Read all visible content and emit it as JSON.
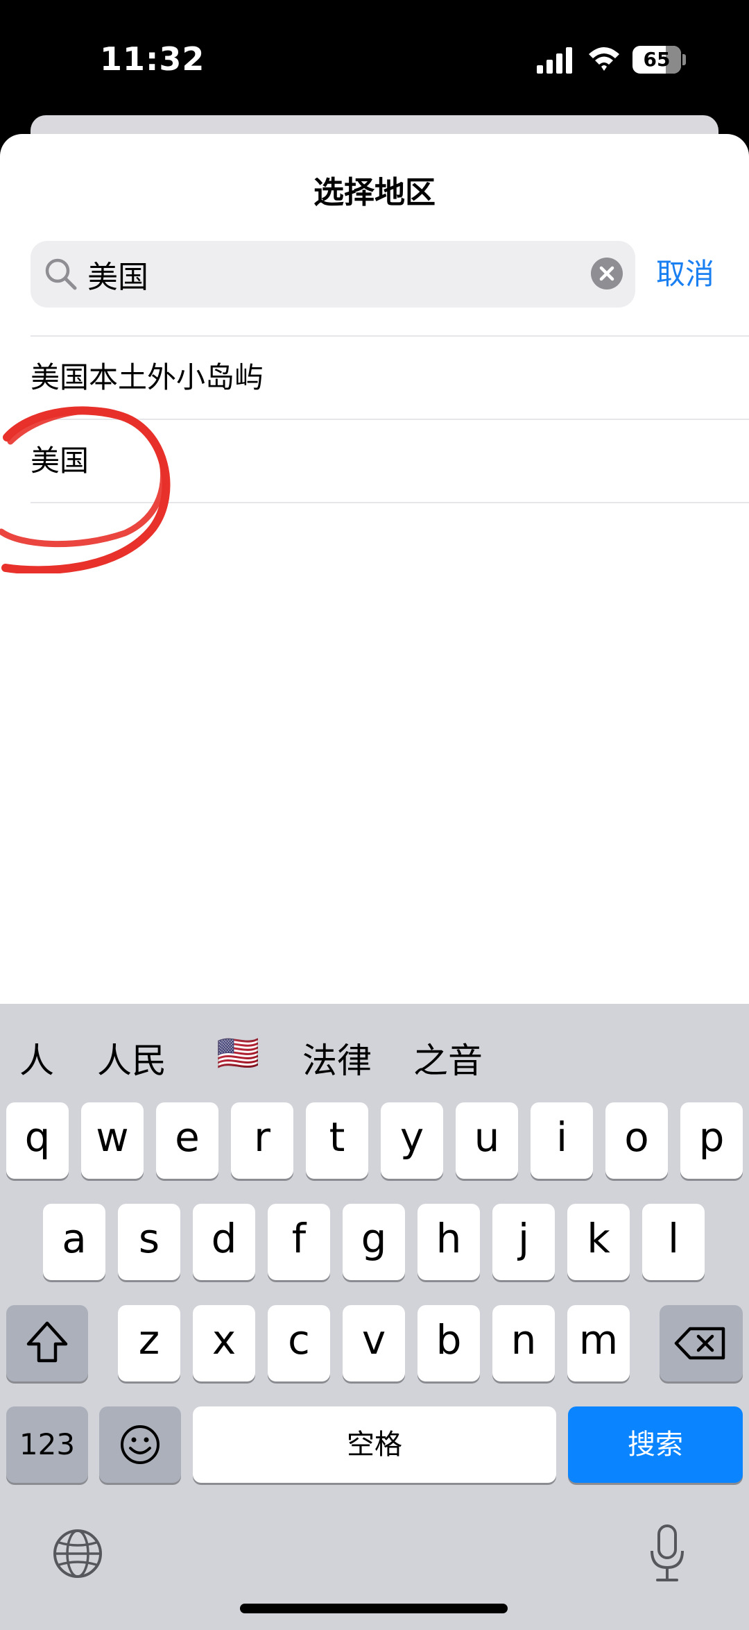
{
  "status_bar": {
    "time": "11:32",
    "battery": "65"
  },
  "sheet": {
    "title": "选择地区",
    "search": {
      "value": "美国",
      "cancel_label": "取消"
    },
    "results": [
      "美国本土外小岛屿",
      "美国"
    ]
  },
  "keyboard": {
    "candidates": [
      "人",
      "人民",
      "🇺🇸",
      "法律",
      "之音"
    ],
    "row1": [
      "q",
      "w",
      "e",
      "r",
      "t",
      "y",
      "u",
      "i",
      "o",
      "p"
    ],
    "row2": [
      "a",
      "s",
      "d",
      "f",
      "g",
      "h",
      "j",
      "k",
      "l"
    ],
    "row3": [
      "z",
      "x",
      "c",
      "v",
      "b",
      "n",
      "m"
    ],
    "numbers_label": "123",
    "space_label": "空格",
    "search_label": "搜索"
  },
  "colors": {
    "accent": "#1a7ff1",
    "search_key": "#0a84ff",
    "annotation": "#e8312a",
    "keyboard_bg": "#d1d3d9"
  }
}
